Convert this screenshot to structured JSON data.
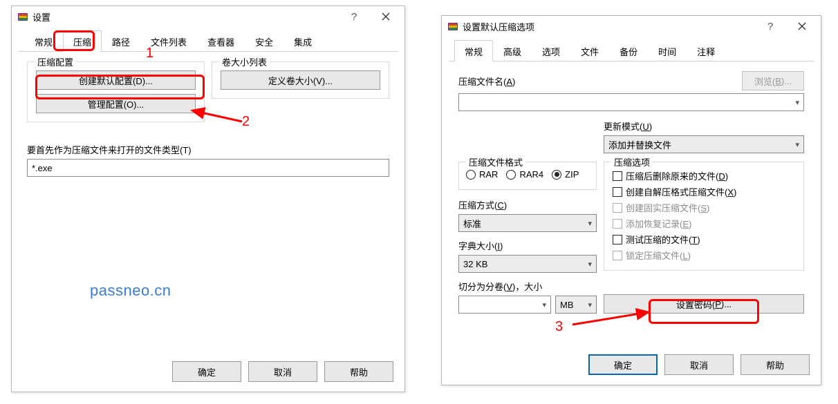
{
  "watermark": "passneo.cn",
  "annotations": {
    "marker1": "1",
    "marker2": "2",
    "marker3": "3"
  },
  "dialog1": {
    "title": "设置",
    "tabs": [
      "常规",
      "压缩",
      "路径",
      "文件列表",
      "查看器",
      "安全",
      "集成"
    ],
    "active_tab": 1,
    "group_compress_profiles": {
      "legend": "压缩配置",
      "btn_create_default": "创建默认配置(D)...",
      "btn_manage": "管理配置(O)..."
    },
    "group_volume": {
      "legend": "卷大小列表",
      "btn_define": "定义卷大小(V)..."
    },
    "open_as_archive_label": "要首先作为压缩文件来打开的文件类型(T)",
    "open_as_archive_value": "*.exe",
    "footer_ok": "确定",
    "footer_cancel": "取消",
    "footer_help": "帮助"
  },
  "dialog2": {
    "title": "设置默认压缩选项",
    "tabs": [
      "常规",
      "高级",
      "选项",
      "文件",
      "备份",
      "时间",
      "注释"
    ],
    "active_tab": 0,
    "archive_name_label": "压缩文件名(",
    "archive_name_ak": "A",
    "archive_name_label2": ")",
    "archive_name_value": "",
    "browse_btn_pre": "浏览(",
    "browse_btn_ak": "B",
    "browse_btn_post": ")...",
    "update_mode_label": "更新模式(",
    "update_mode_ak": "U",
    "update_mode_label2": ")",
    "update_mode_value": "添加并替换文件",
    "group_format": {
      "legend": "压缩文件格式",
      "opt_rar": "RAR",
      "opt_rar4": "RAR4",
      "opt_zip": "ZIP",
      "selected": "ZIP"
    },
    "method_label": "压缩方式(",
    "method_ak": "C",
    "method_label2": ")",
    "method_value": "标准",
    "dict_label": "字典大小(",
    "dict_ak": "I",
    "dict_label2": ")",
    "dict_value": "32 KB",
    "split_label": "切分为分卷(",
    "split_ak": "V",
    "split_label2": ")，大小",
    "split_value": "",
    "split_unit": "MB",
    "group_options": {
      "legend": "压缩选项",
      "delete_after": "压缩后删除原来的文件(",
      "delete_after_ak": "D",
      "sfx": "创建自解压格式压缩文件(",
      "sfx_ak": "X",
      "solid": "创建固实压缩文件(",
      "solid_ak": "S",
      "recovery": "添加恢复记录(",
      "recovery_ak": "E",
      "test": "测试压缩的文件(",
      "test_ak": "T",
      "lock": "锁定压缩文件(",
      "lock_ak": "L"
    },
    "set_password_btn": "设置密码(",
    "set_password_ak": "P",
    "set_password_post": ")...",
    "footer_ok": "确定",
    "footer_cancel": "取消",
    "footer_help": "帮助"
  }
}
